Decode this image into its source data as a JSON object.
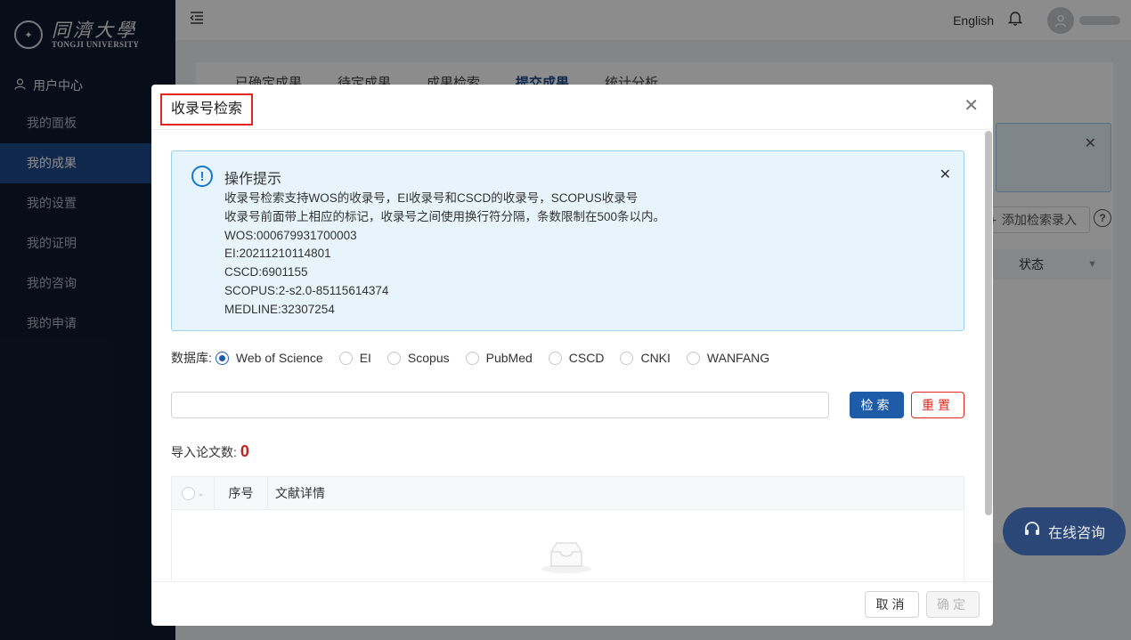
{
  "sidebar": {
    "logo_cn": "同濟大學",
    "logo_en": "TONGJI UNIVERSITY",
    "group_label": "用户中心",
    "items": [
      {
        "label": "我的面板"
      },
      {
        "label": "我的成果",
        "active": true
      },
      {
        "label": "我的设置"
      },
      {
        "label": "我的证明"
      },
      {
        "label": "我的咨询"
      },
      {
        "label": "我的申请"
      }
    ]
  },
  "header": {
    "language": "English"
  },
  "background": {
    "tabs": [
      "已确定成果",
      "待定成果",
      "成果检索",
      "提交成果",
      "统计分析"
    ],
    "active_tab": 3,
    "add_button": "添加检索录入",
    "status_header": "状态"
  },
  "consult": {
    "label": "在线咨询"
  },
  "modal": {
    "title": "收录号检索",
    "info": {
      "title": "操作提示",
      "lines": [
        "收录号检索支持WOS的收录号，EI收录号和CSCD的收录号，SCOPUS收录号",
        "收录号前面带上相应的标记，收录号之间使用换行符分隔，条数限制在500条以内。",
        "WOS:000679931700003",
        "EI:20211210114801",
        "CSCD:6901155",
        "SCOPUS:2-s2.0-85115614374",
        "MEDLINE:32307254"
      ]
    },
    "database_label": "数据库:",
    "databases": [
      {
        "label": "Web of Science",
        "checked": true
      },
      {
        "label": "EI",
        "checked": false
      },
      {
        "label": "Scopus",
        "checked": false
      },
      {
        "label": "PubMed",
        "checked": false
      },
      {
        "label": "CSCD",
        "checked": false
      },
      {
        "label": "CNKI",
        "checked": false
      },
      {
        "label": "WANFANG",
        "checked": false
      }
    ],
    "search_input": {
      "value": "",
      "placeholder": ""
    },
    "search_button": "检索",
    "reset_button": "重置",
    "count_label": "导入论文数:",
    "count_value": "0",
    "table": {
      "columns": [
        "序号",
        "文献详情"
      ],
      "rows": []
    },
    "cancel_button": "取消",
    "ok_button": "确定"
  },
  "colors": {
    "sidebar_bg": "#0e1b2e",
    "primary": "#1e5ca8",
    "danger": "#e0281e",
    "info_bg": "#e8f4fb"
  }
}
